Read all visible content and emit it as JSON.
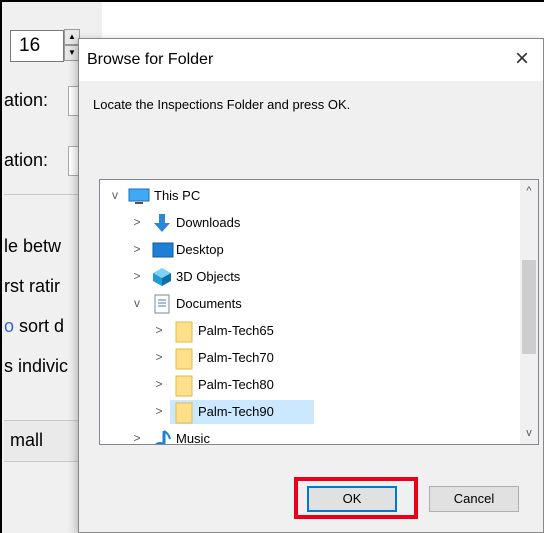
{
  "background_app": {
    "spin_value": "16",
    "spin_up": "▲",
    "spin_down": "▼",
    "label_1": "ation:",
    "label_2": "ation:",
    "text_1": "le betw",
    "text_2": "rst ratir",
    "text_3_blue": "o",
    "text_3": " sort d",
    "text_4": "s indivic",
    "dropdown_value": "mall"
  },
  "dialog": {
    "title": "Browse for Folder",
    "close": "×",
    "instruction": "Locate the Inspections Folder and press OK.",
    "tree": [
      {
        "label": "This PC",
        "expander": "v",
        "icon": "pc-icon"
      },
      {
        "label": "Downloads",
        "expander": ">",
        "icon": "downloads-icon"
      },
      {
        "label": "Desktop",
        "expander": ">",
        "icon": "desktop-icon"
      },
      {
        "label": "3D Objects",
        "expander": ">",
        "icon": "3d-objects-icon"
      },
      {
        "label": "Documents",
        "expander": "v",
        "icon": "documents-icon"
      },
      {
        "label": "Palm-Tech65",
        "expander": ">",
        "icon": "folder-icon"
      },
      {
        "label": "Palm-Tech70",
        "expander": ">",
        "icon": "folder-icon"
      },
      {
        "label": "Palm-Tech80",
        "expander": ">",
        "icon": "folder-icon"
      },
      {
        "label": "Palm-Tech90",
        "expander": ">",
        "icon": "folder-icon",
        "selected": true
      },
      {
        "label": "Music",
        "expander": ">",
        "icon": "music-icon"
      }
    ],
    "scroll_up": "^",
    "scroll_down": "v",
    "ok_label": "OK",
    "cancel_label": "Cancel"
  },
  "colors": {
    "selection": "#cce8ff",
    "highlight_box": "#e8001c",
    "ok_border": "#0078d7"
  }
}
